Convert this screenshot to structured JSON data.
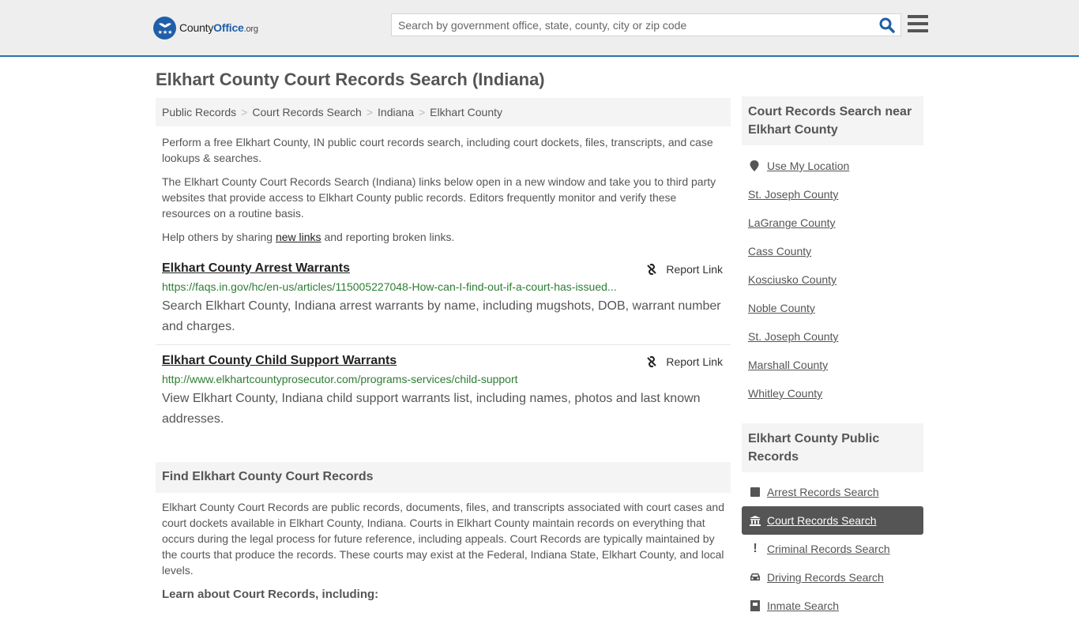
{
  "header": {
    "logo": {
      "county": "County",
      "office": "Office",
      "org": ".org"
    },
    "search_placeholder": "Search by government office, state, county, city or zip code",
    "search_value": ""
  },
  "page": {
    "title": "Elkhart County Court Records Search (Indiana)"
  },
  "breadcrumb": [
    "Public Records",
    "Court Records Search",
    "Indiana",
    "Elkhart County"
  ],
  "intro": {
    "p1": "Perform a free Elkhart County, IN public court records search, including court dockets, files, transcripts, and case lookups & searches.",
    "p2": "The Elkhart County Court Records Search (Indiana) links below open in a new window and take you to third party websites that provide access to Elkhart County public records. Editors frequently monitor and verify these resources on a routine basis.",
    "p3_before": "Help others by sharing ",
    "p3_link": "new links",
    "p3_after": " and reporting broken links."
  },
  "results": [
    {
      "title": "Elkhart County Arrest Warrants",
      "url": "https://faqs.in.gov/hc/en-us/articles/115005227048-How-can-I-find-out-if-a-court-has-issued...",
      "description": "Search Elkhart County, Indiana arrest warrants by name, including mugshots, DOB, warrant number and charges.",
      "report_label": "Report Link"
    },
    {
      "title": "Elkhart County Child Support Warrants",
      "url": "http://www.elkhartcountyprosecutor.com/programs-services/child-support",
      "description": "View Elkhart County, Indiana child support warrants list, including names, photos and last known addresses.",
      "report_label": "Report Link"
    }
  ],
  "find_section": {
    "heading": "Find Elkhart County Court Records",
    "body": "Elkhart County Court Records are public records, documents, files, and transcripts associated with court cases and court dockets available in Elkhart County, Indiana. Courts in Elkhart County maintain records on everything that occurs during the legal process for future reference, including appeals. Court Records are typically maintained by the courts that produce the records. These courts may exist at the Federal, Indiana State, Elkhart County, and local levels.",
    "learn_heading": "Learn about Court Records, including:"
  },
  "sidebar": {
    "nearby_heading": "Court Records Search near Elkhart County",
    "use_location": "Use My Location",
    "nearby": [
      "St. Joseph County",
      "LaGrange County",
      "Cass County",
      "Kosciusko County",
      "Noble County",
      "St. Joseph County",
      "Marshall County",
      "Whitley County"
    ],
    "public_heading": "Elkhart County Public Records",
    "public_items": [
      {
        "label": "Arrest Records Search",
        "icon": "square-icon",
        "active": false
      },
      {
        "label": "Court Records Search",
        "icon": "courthouse-icon",
        "active": true
      },
      {
        "label": "Criminal Records Search",
        "icon": "exclamation-icon",
        "active": false
      },
      {
        "label": "Driving Records Search",
        "icon": "car-icon",
        "active": false
      },
      {
        "label": "Inmate Search",
        "icon": "jail-icon",
        "active": false
      }
    ]
  }
}
